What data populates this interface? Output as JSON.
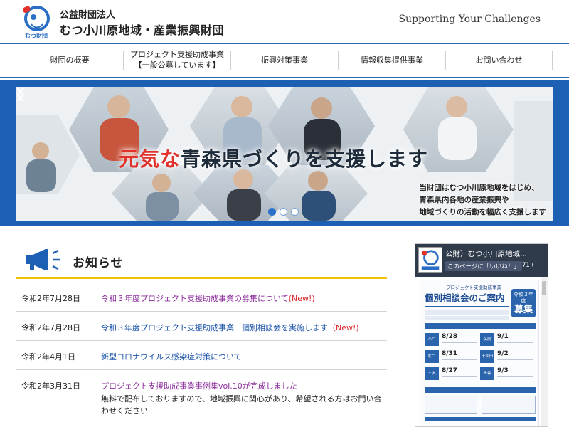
{
  "header": {
    "org_type": "公益財団法人",
    "org_name": "むつ小川原地域・産業振興財団",
    "logo_caption": "むつ財団",
    "tagline": "Supporting Your Challenges"
  },
  "nav": [
    {
      "lines": [
        "財団の概要"
      ]
    },
    {
      "lines": [
        "プロジェクト支援助成事業",
        "【一般公募しています】"
      ]
    },
    {
      "lines": [
        "振興対策事業"
      ]
    },
    {
      "lines": [
        "情報収集提供事業"
      ]
    },
    {
      "lines": [
        "お問い合わせ"
      ]
    }
  ],
  "banner": {
    "slogan_accent": "元気な",
    "slogan_rest": "青森県づくりを支援します",
    "description": [
      "当財団はむつ小川原地域をはじめ、",
      "青森県内各地の産業振興や",
      "地域づくりの活動を幅広く支援します"
    ],
    "slide_count": 3,
    "active_slide": 1
  },
  "news": {
    "title": "お知らせ",
    "items": [
      {
        "date": "令和2年7月28日",
        "link": "令和３年度プロジェクト支援助成事業の募集について",
        "new": "(New!)",
        "text": "",
        "color": "purple"
      },
      {
        "date": "令和2年7月28日",
        "link": "令和３年度プロジェクト支援助成事業　個別相談会を実施します",
        "new": "（New!)",
        "text": "",
        "color": "blue"
      },
      {
        "date": "令和2年4月1日",
        "link": "新型コロナウイルス感染症対策について",
        "new": "",
        "text": "",
        "color": "blue"
      },
      {
        "date": "令和2年3月31日",
        "link": "プロジェクト支援助成事業事例集vol.10が完成しました",
        "new": "",
        "text": "無料で配布しておりますので、地域振興に関心があり、希望される方はお問い合わせください",
        "color": "purple"
      }
    ]
  },
  "facebook": {
    "page_name": "公財）むつ小川原地域...",
    "like_label": "このページに「いいね！」",
    "like_count": "71 (",
    "flyer_subtitle": "プロジェクト支援助成事業",
    "flyer_title": "個別相談会のご案内",
    "flyer_badge_top": "令和３年度",
    "flyer_badge_main": "募集",
    "flyer_rows": [
      {
        "left_area": "八戸",
        "left_date": "8/28",
        "right_area": "弘前",
        "right_date": "9/1"
      },
      {
        "left_area": "むつ",
        "left_date": "8/31",
        "right_area": "十和田",
        "right_date": "9/2"
      },
      {
        "left_area": "三沢",
        "left_date": "8/27",
        "right_area": "青森",
        "right_date": "9/3"
      }
    ]
  },
  "colors": {
    "brand_blue": "#2868b4",
    "banner_blue": "#1c5fb3",
    "accent_yellow": "#f2c200",
    "new_red": "#d8282c",
    "link_blue": "#1a52a8",
    "link_purple": "#8a2c9a"
  }
}
